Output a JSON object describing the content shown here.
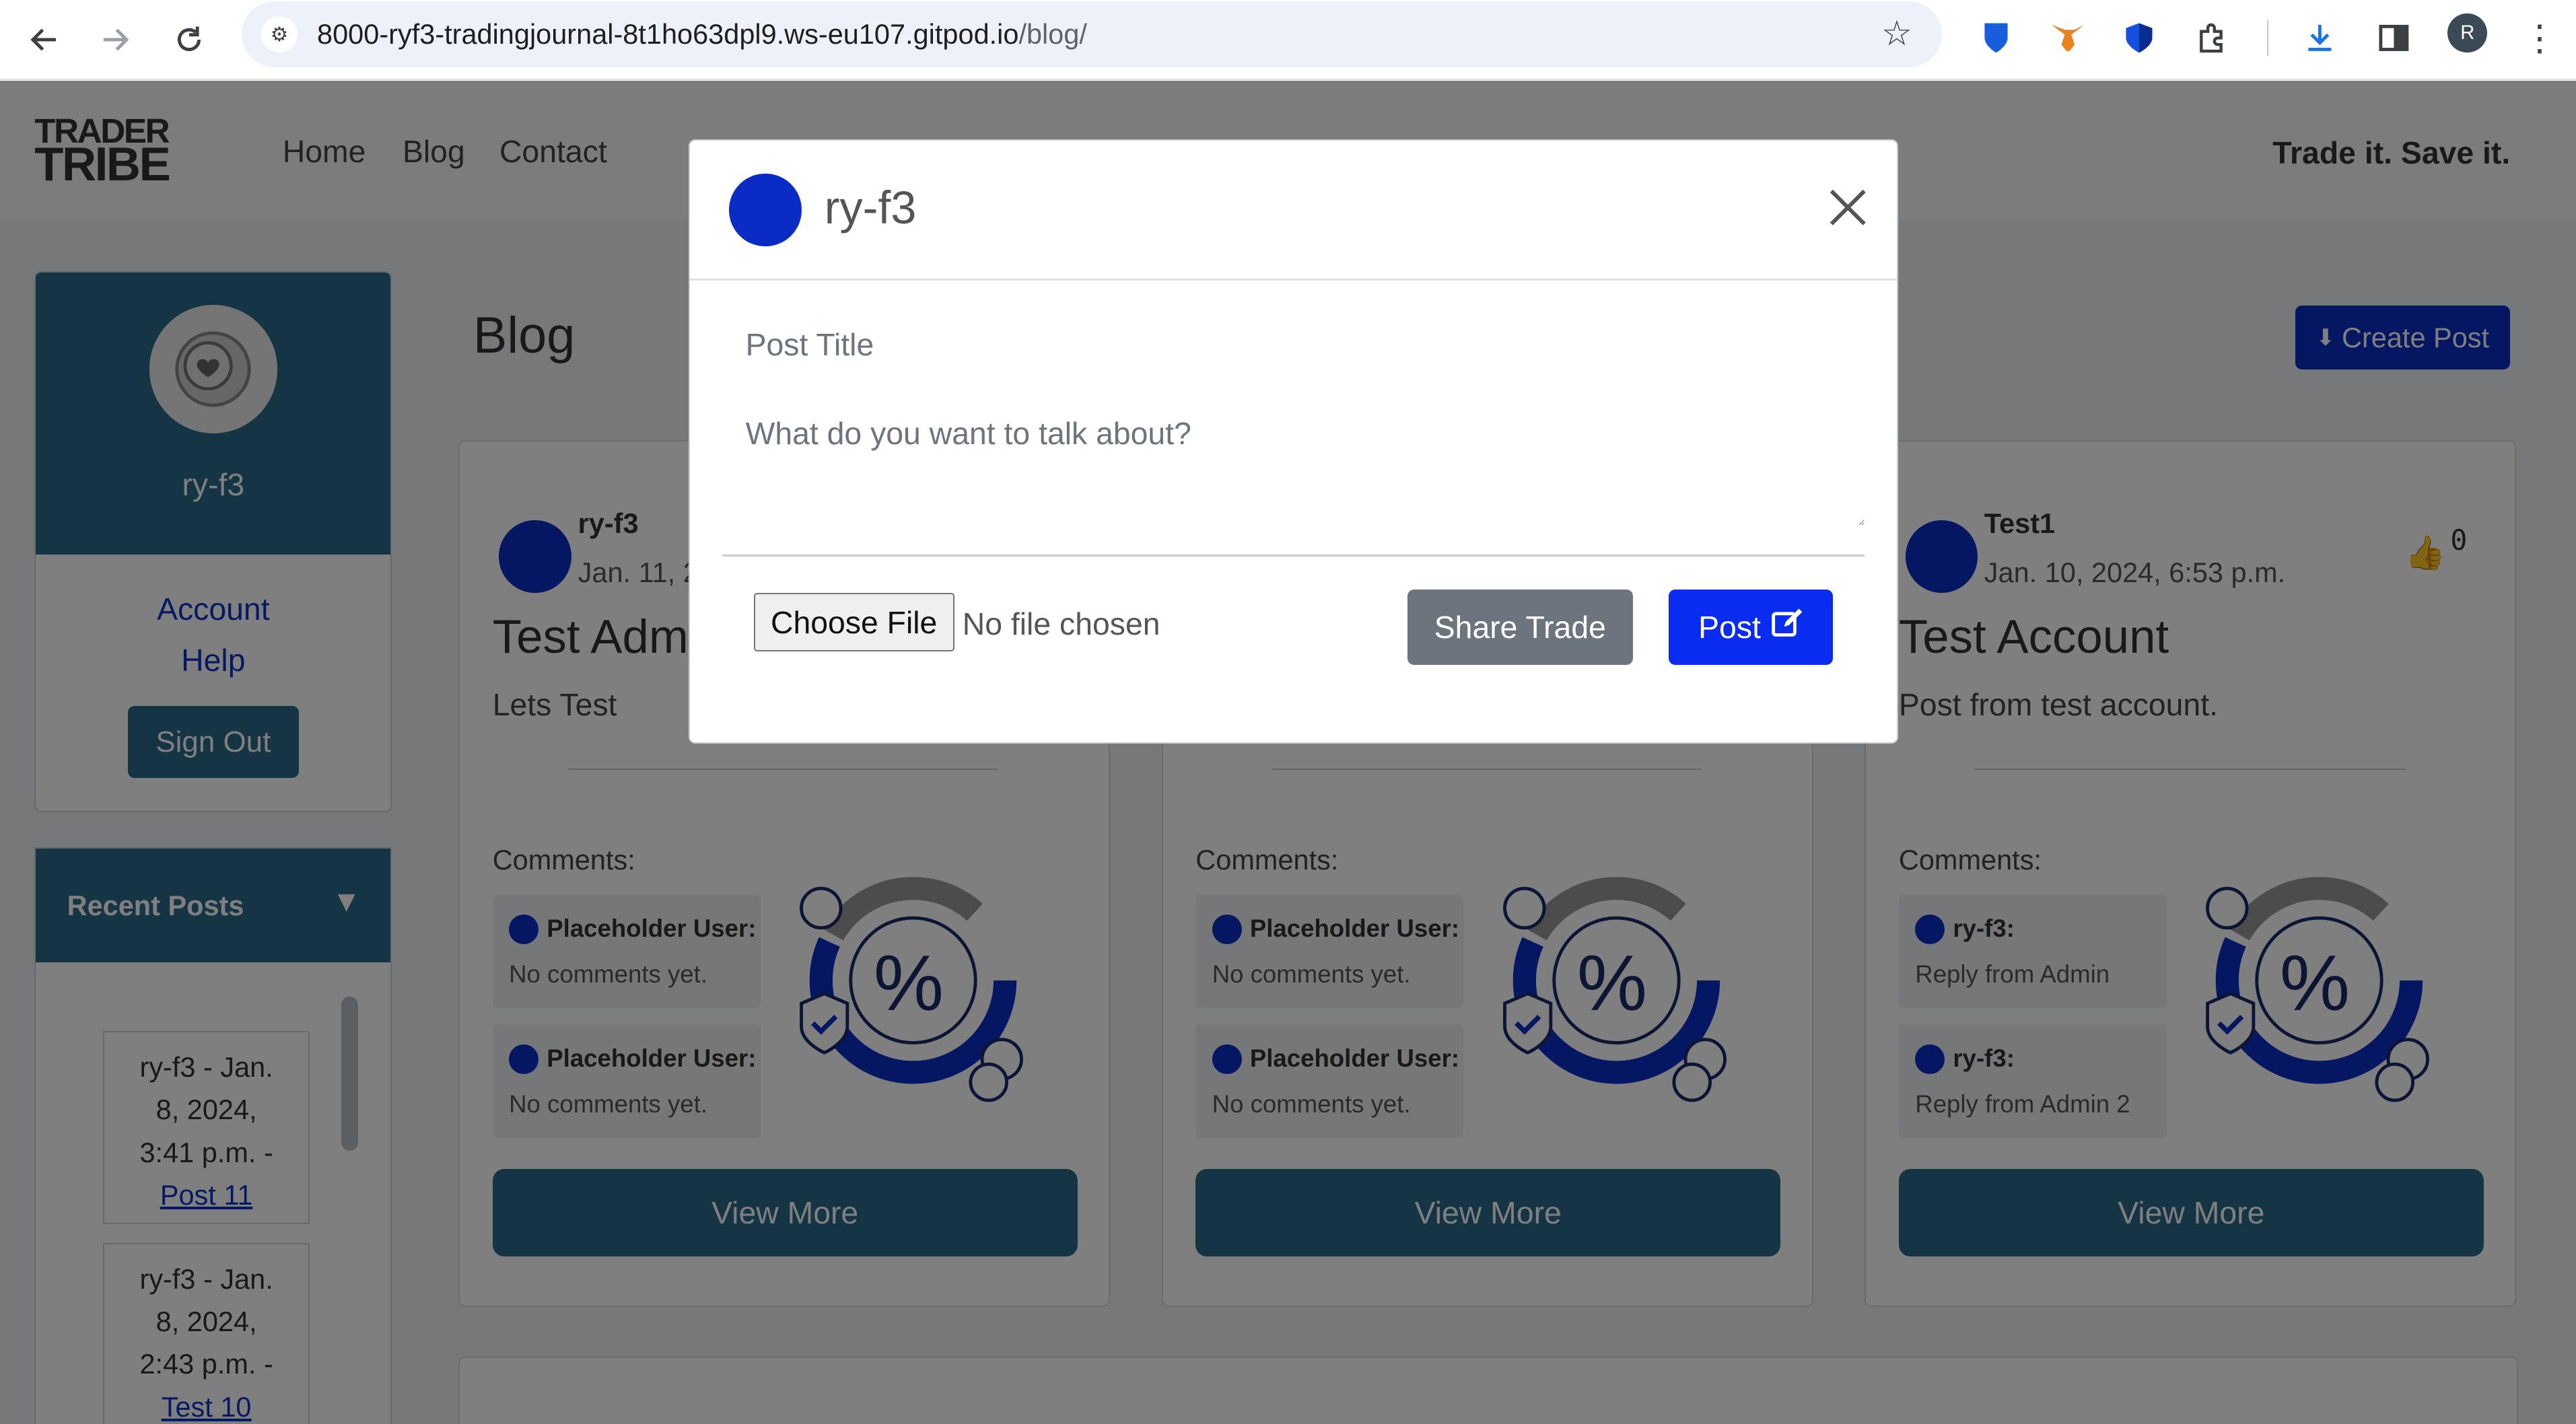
{
  "browser": {
    "url_host": "8000-ryf3-tradingjournal-8t1ho63dpl9.ws-eu107.gitpod.io",
    "url_path": "/blog/",
    "profile_initial": "R"
  },
  "site": {
    "logo_line1": "TRADER",
    "logo_line2": "TRIBE",
    "nav": [
      "Home",
      "Blog",
      "Contact"
    ],
    "tagline": "Trade it. Save it."
  },
  "profile": {
    "username": "ry-f3",
    "account": "Account",
    "help": "Help",
    "sign_out": "Sign Out"
  },
  "recent_posts": {
    "title": "Recent Posts",
    "items": [
      {
        "line1": "ry-f3 - Jan.",
        "line2": "8, 2024,",
        "line3": "3:41 p.m. -",
        "link": "Post 11"
      },
      {
        "line1": "ry-f3 - Jan.",
        "line2": "8, 2024,",
        "line3": "2:43 p.m. -",
        "link": "Test 10"
      }
    ]
  },
  "blog": {
    "heading": "Blog",
    "create_post": "Create Post",
    "comments_label": "Comments:",
    "view_more": "View More",
    "cards": [
      {
        "author": "ry-f3",
        "date": "Jan. 11, 2",
        "title": "Test Adm",
        "body": "Lets Test",
        "comments": [
          {
            "user": "Placeholder User:",
            "text": "No comments yet."
          },
          {
            "user": "Placeholder User:",
            "text": "No comments yet."
          }
        ]
      },
      {
        "author": "",
        "date": "",
        "title": "",
        "body": "",
        "comments": [
          {
            "user": "Placeholder User:",
            "text": "No comments yet."
          },
          {
            "user": "Placeholder User:",
            "text": "No comments yet."
          }
        ]
      },
      {
        "author": "Test1",
        "date": "Jan. 10, 2024, 6:53 p.m.",
        "title": "Test Account",
        "body": "Post from test account.",
        "likes": "0",
        "comments": [
          {
            "user": "ry-f3:",
            "text": "Reply from Admin"
          },
          {
            "user": "ry-f3:",
            "text": "Reply from Admin 2"
          }
        ]
      }
    ]
  },
  "modal": {
    "username": "ry-f3",
    "title_placeholder": "Post Title",
    "body_placeholder": "What do you want to talk about?",
    "choose_file": "Choose File",
    "no_file": "No file chosen",
    "share_trade": "Share Trade",
    "post": "Post"
  },
  "colors": {
    "brand_blue": "#0a2cc5",
    "teal": "#2a6a8b",
    "grey_button": "#6c757d"
  },
  "icons": [
    "back-arrow-icon",
    "forward-arrow-icon",
    "reload-icon",
    "site-info-icon",
    "bookmark-star-icon",
    "close-icon",
    "thumbs-up-icon",
    "edit-icon",
    "download-icon",
    "triangle-down-icon"
  ]
}
